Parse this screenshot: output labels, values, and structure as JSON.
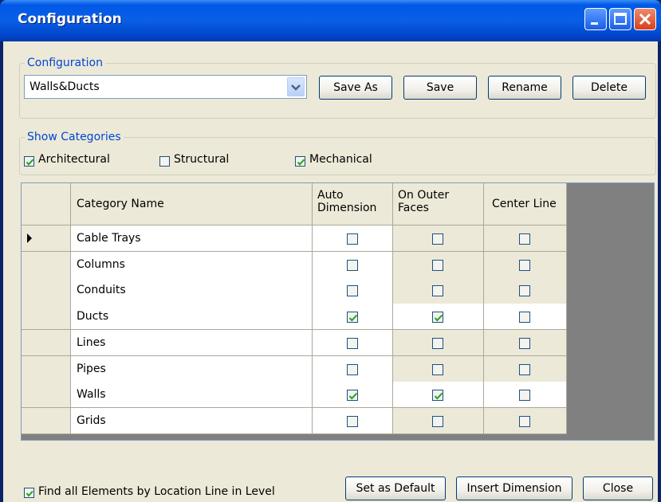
{
  "window": {
    "title": "Configuration"
  },
  "configuration_group": {
    "legend": "Configuration",
    "selected": "Walls&Ducts",
    "buttons": {
      "save_as": "Save As",
      "save": "Save",
      "rename": "Rename",
      "delete": "Delete"
    }
  },
  "categories_group": {
    "legend": "Show Categories",
    "items": [
      {
        "label": "Architectural",
        "checked": true
      },
      {
        "label": "Structural",
        "checked": false
      },
      {
        "label": "Mechanical",
        "checked": true
      }
    ]
  },
  "grid": {
    "columns": [
      "Category Name",
      "Auto\nDimension",
      "On Outer\nFaces",
      "Center Line"
    ],
    "rows": [
      {
        "name": "Cable Trays",
        "auto": false,
        "outer": false,
        "center": false,
        "current": true
      },
      {
        "name": "Columns",
        "auto": false,
        "outer": false,
        "center": false
      },
      {
        "name": "Conduits",
        "auto": false,
        "outer": false,
        "center": false
      },
      {
        "name": "Ducts",
        "auto": true,
        "outer": true,
        "center": false
      },
      {
        "name": "Lines",
        "auto": false,
        "outer": false,
        "center": false
      },
      {
        "name": "Pipes",
        "auto": false,
        "outer": false,
        "center": false
      },
      {
        "name": "Walls",
        "auto": true,
        "outer": true,
        "center": false
      },
      {
        "name": "Grids",
        "auto": false,
        "outer": false,
        "center": false
      }
    ]
  },
  "footer": {
    "find_all_label": "Find all Elements by Location Line in Level",
    "find_all_checked": true,
    "buttons": {
      "set_default": "Set as Default",
      "insert_dimension": "Insert Dimension",
      "close": "Close"
    }
  },
  "colors": {
    "check": "#21a121",
    "title_bar": "#0058e6",
    "legend": "#0046d5"
  }
}
